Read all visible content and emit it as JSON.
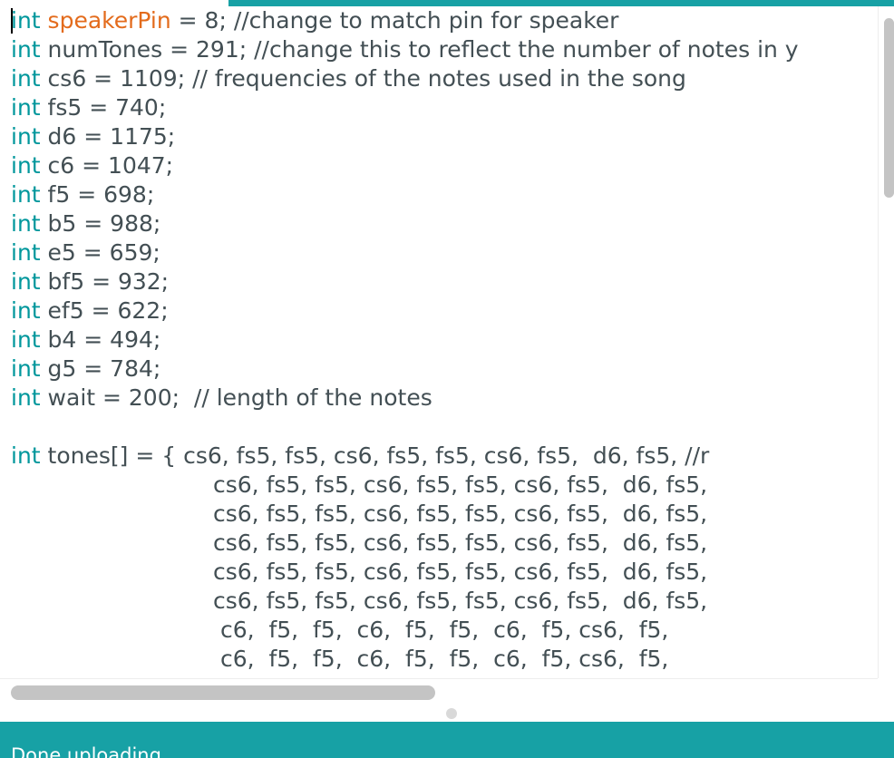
{
  "colors": {
    "accent": "#17a1a5",
    "keyword": "#00979c",
    "highlight_identifier": "#e36b1c",
    "text": "#434f54"
  },
  "editor": {
    "lines": [
      [
        "speakerPin",
        " = 8; //change to match pin for speaker"
      ],
      [
        "numTones",
        " = 291; //change this to reflect the number of notes in y"
      ],
      [
        "cs6",
        " = 1109; // frequencies of the notes used in the song"
      ],
      [
        "fs5",
        " = 740;"
      ],
      [
        "d6",
        " = 1175;"
      ],
      [
        "c6",
        " = 1047;"
      ],
      [
        "f5",
        " = 698;"
      ],
      [
        "b5",
        " = 988;"
      ],
      [
        "e5",
        " = 659;"
      ],
      [
        "bf5",
        " = 932;"
      ],
      [
        "ef5",
        " = 622;"
      ],
      [
        "b4",
        " = 494;"
      ],
      [
        "g5",
        " = 784;"
      ],
      [
        "wait",
        " = 200;  // length of the notes"
      ]
    ],
    "keyword": "int",
    "tones_decl": "tones[] = { cs6, fs5, fs5, cs6, fs5, fs5, cs6, fs5,  d6, fs5, //r",
    "tones_rows": [
      "cs6, fs5, fs5, cs6, fs5, fs5, cs6, fs5,  d6, fs5,",
      "cs6, fs5, fs5, cs6, fs5, fs5, cs6, fs5,  d6, fs5,",
      "cs6, fs5, fs5, cs6, fs5, fs5, cs6, fs5,  d6, fs5,",
      "cs6, fs5, fs5, cs6, fs5, fs5, cs6, fs5,  d6, fs5,",
      "cs6, fs5, fs5, cs6, fs5, fs5, cs6, fs5,  d6, fs5,",
      " c6,  f5,  f5,  c6,  f5,  f5,  c6,  f5, cs6,  f5,",
      " c6,  f5,  f5,  c6,  f5,  f5,  c6,  f5, cs6,  f5,"
    ]
  },
  "status": {
    "message": "Done uploading."
  }
}
